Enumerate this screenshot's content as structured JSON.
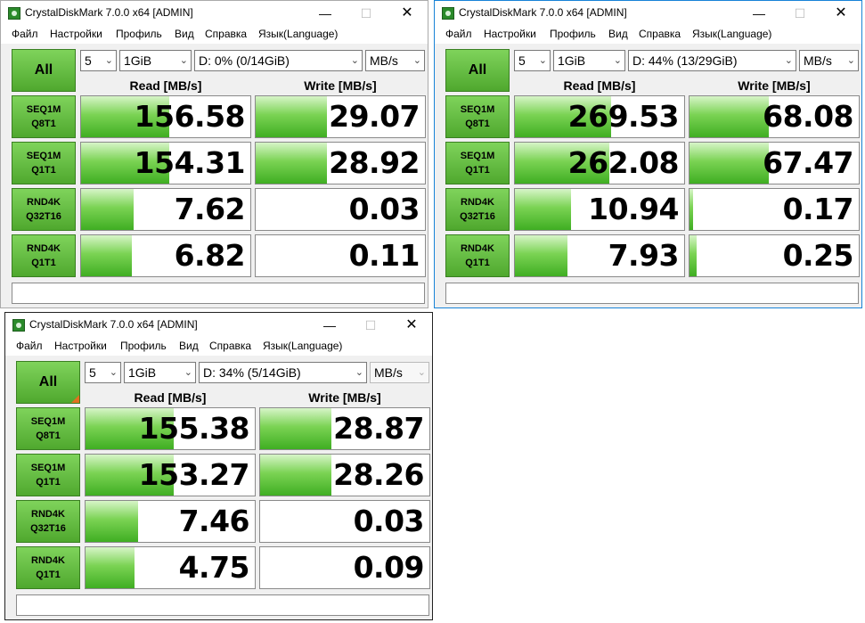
{
  "windows": [
    {
      "title": "CrystalDiskMark 7.0.0 x64 [ADMIN]",
      "menu": [
        "Файл",
        "Настройки",
        "Профиль",
        "Вид",
        "Справка",
        "Язык(Language)"
      ],
      "all_label": "All",
      "count": "5",
      "size": "1GiB",
      "drive": "D: 0% (0/14GiB)",
      "unit": "MB/s",
      "read_header": "Read [MB/s]",
      "write_header": "Write [MB/s]",
      "tests": [
        {
          "line1": "SEQ1M",
          "line2": "Q8T1",
          "read": "156.58",
          "write": "29.07",
          "read_fill": 0.52,
          "write_fill": 0.42
        },
        {
          "line1": "SEQ1M",
          "line2": "Q1T1",
          "read": "154.31",
          "write": "28.92",
          "read_fill": 0.52,
          "write_fill": 0.42
        },
        {
          "line1": "RND4K",
          "line2": "Q32T16",
          "read": "7.62",
          "write": "0.03",
          "read_fill": 0.31,
          "write_fill": 0.0
        },
        {
          "line1": "RND4K",
          "line2": "Q1T1",
          "read": "6.82",
          "write": "0.11",
          "read_fill": 0.3,
          "write_fill": 0.0
        }
      ],
      "comment": ""
    },
    {
      "title": "CrystalDiskMark 7.0.0 x64 [ADMIN]",
      "menu": [
        "Файл",
        "Настройки",
        "Профиль",
        "Вид",
        "Справка",
        "Язык(Language)"
      ],
      "all_label": "All",
      "count": "5",
      "size": "1GiB",
      "drive": "D: 44% (13/29GiB)",
      "unit": "MB/s",
      "read_header": "Read [MB/s]",
      "write_header": "Write [MB/s]",
      "tests": [
        {
          "line1": "SEQ1M",
          "line2": "Q8T1",
          "read": "269.53",
          "write": "68.08",
          "read_fill": 0.57,
          "write_fill": 0.47
        },
        {
          "line1": "SEQ1M",
          "line2": "Q1T1",
          "read": "262.08",
          "write": "67.47",
          "read_fill": 0.56,
          "write_fill": 0.47
        },
        {
          "line1": "RND4K",
          "line2": "Q32T16",
          "read": "10.94",
          "write": "0.17",
          "read_fill": 0.33,
          "write_fill": 0.02
        },
        {
          "line1": "RND4K",
          "line2": "Q1T1",
          "read": "7.93",
          "write": "0.25",
          "read_fill": 0.31,
          "write_fill": 0.04
        }
      ],
      "comment": ""
    },
    {
      "title": "CrystalDiskMark 7.0.0 x64 [ADMIN]",
      "menu": [
        "Файл",
        "Настройки",
        "Профиль",
        "Вид",
        "Справка",
        "Язык(Language)"
      ],
      "all_label": "All",
      "count": "5",
      "size": "1GiB",
      "drive": "D: 34% (5/14GiB)",
      "unit": "MB/s",
      "read_header": "Read [MB/s]",
      "write_header": "Write [MB/s]",
      "tests": [
        {
          "line1": "SEQ1M",
          "line2": "Q8T1",
          "read": "155.38",
          "write": "28.87",
          "read_fill": 0.52,
          "write_fill": 0.42
        },
        {
          "line1": "SEQ1M",
          "line2": "Q1T1",
          "read": "153.27",
          "write": "28.26",
          "read_fill": 0.52,
          "write_fill": 0.42
        },
        {
          "line1": "RND4K",
          "line2": "Q32T16",
          "read": "7.46",
          "write": "0.03",
          "read_fill": 0.31,
          "write_fill": 0.0
        },
        {
          "line1": "RND4K",
          "line2": "Q1T1",
          "read": "4.75",
          "write": "0.09",
          "read_fill": 0.29,
          "write_fill": 0.0
        }
      ],
      "comment": ""
    }
  ]
}
